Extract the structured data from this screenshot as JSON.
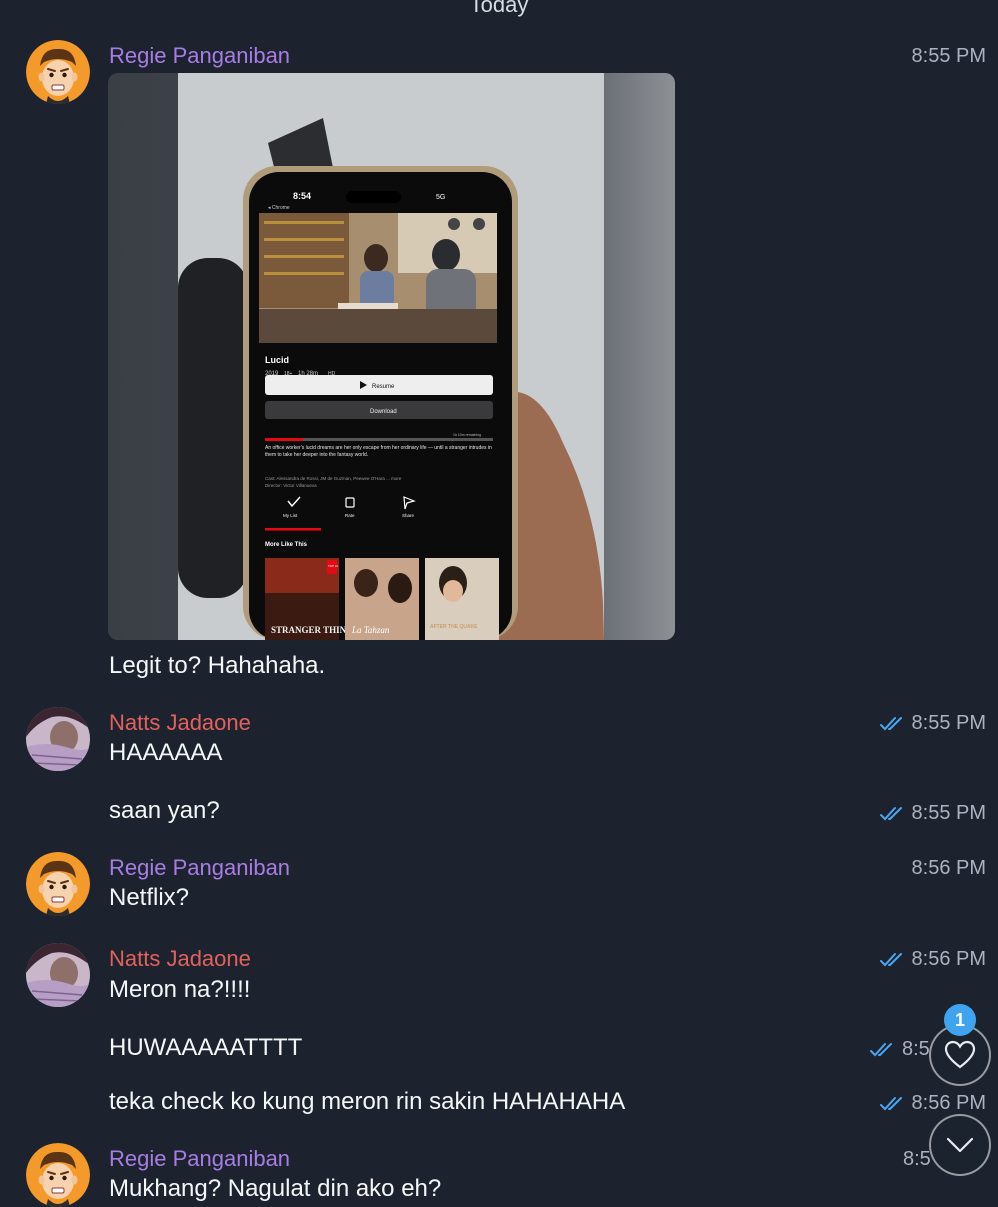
{
  "date_separator": "Today",
  "users": {
    "regie": "Regie Panganiban",
    "natts": "Natts Jadaone"
  },
  "messages": [
    {
      "sender": "Regie Panganiban",
      "time": "8:55 PM",
      "text": "Legit to? Hahahaha.",
      "has_photo": true
    },
    {
      "sender": "Natts Jadaone",
      "time": "8:55 PM",
      "text": "HAAAAAA",
      "read": true
    },
    {
      "sender": "Natts Jadaone",
      "time": "8:55 PM",
      "text": "saan yan?",
      "read": true
    },
    {
      "sender": "Regie Panganiban",
      "time": "8:56 PM",
      "text": "Netflix?"
    },
    {
      "sender": "Natts Jadaone",
      "time": "8:56 PM",
      "text": "Meron na?!!!!",
      "read": true
    },
    {
      "sender": "Natts Jadaone",
      "time": "8:5",
      "text": "HUWAAAAATTTT",
      "read": true
    },
    {
      "sender": "Natts Jadaone",
      "time": "8:56 PM",
      "text": "teka check ko kung meron rin sakin HAHAHAHA",
      "read": true
    },
    {
      "sender": "Regie Panganiban",
      "time": "8:5",
      "text": "Mukhang? Nagulat din ako eh?"
    }
  ],
  "photo": {
    "phone_time": "8:54",
    "phone_signal": "5G",
    "back_label": "◂ Chrome",
    "title": "Lucid",
    "meta_year": "2019",
    "meta_rating": "18+",
    "meta_duration": "1h 28m",
    "meta_hd": "HD",
    "resume": "Resume",
    "download": "Download",
    "remaining": "1h 10m remaining",
    "description": "An office worker's lucid dreams are her only escape from her ordinary life — until a stranger intrudes in them to take her deeper into the fantasy world.",
    "cast": "Cast: Alessandra de Rossi, JM de Guzman, Peewee O'Hara ... more",
    "director": "Director: Victor Villanueva",
    "actions": [
      "My List",
      "Rate",
      "Share"
    ],
    "more_like_this": "More Like This",
    "posters": [
      "STRANGER THINGS",
      "La Tahzan",
      "AFTER THE QUAKE"
    ],
    "top10": "TOP 10"
  },
  "fab": {
    "unread_count": "1"
  },
  "colors": {
    "background": "#1c232e",
    "name_regie": "#a77de4",
    "name_natts": "#e2615c",
    "read_ticks": "#4aa7f0",
    "badge": "#3fa3f0"
  }
}
